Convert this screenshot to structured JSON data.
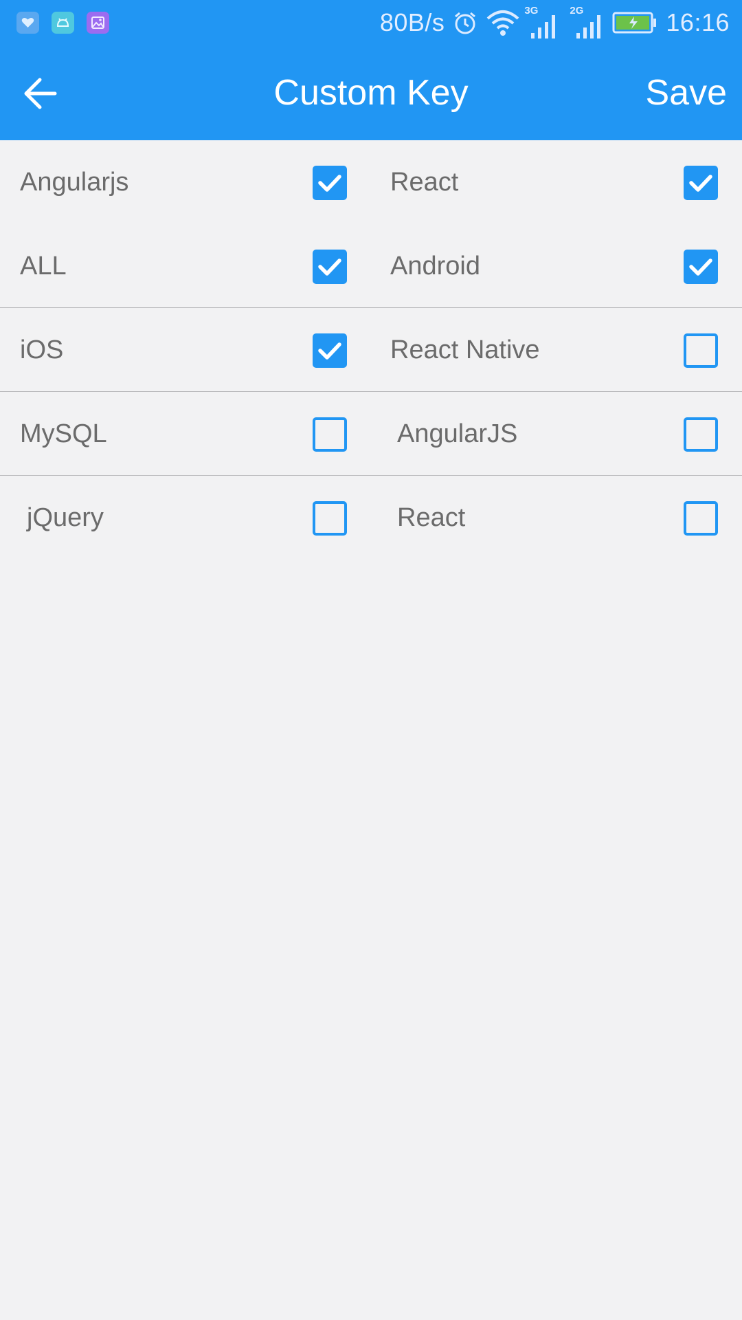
{
  "status_bar": {
    "network_speed": "80B/s",
    "signal1_type": "3G",
    "signal2_type": "2G",
    "time": "16:16",
    "notification_icons": [
      "health-icon",
      "android-icon",
      "gallery-icon"
    ],
    "status_icons": [
      "alarm-icon",
      "wifi-icon",
      "signal-3g-icon",
      "signal-2g-icon",
      "battery-charging-icon"
    ]
  },
  "app_bar": {
    "back_icon": "arrow-left-icon",
    "title": "Custom Key",
    "save_label": "Save"
  },
  "colors": {
    "primary": "#2196f3",
    "background": "#f2f2f3",
    "label_text": "#6b6b6b",
    "divider": "#b9b9bb"
  },
  "keys": [
    {
      "left": {
        "label": "Angularjs",
        "checked": true
      },
      "right": {
        "label": "React",
        "checked": true
      }
    },
    {
      "left": {
        "label": "ALL",
        "checked": true
      },
      "right": {
        "label": "Android",
        "checked": true
      }
    },
    {
      "left": {
        "label": "iOS",
        "checked": true
      },
      "right": {
        "label": "React Native",
        "checked": false
      }
    },
    {
      "left": {
        "label": "MySQL",
        "checked": false
      },
      "right": {
        "label": "AngularJS",
        "checked": false
      }
    },
    {
      "left": {
        "label": "jQuery",
        "checked": false
      },
      "right": {
        "label": "React",
        "checked": false
      }
    }
  ]
}
